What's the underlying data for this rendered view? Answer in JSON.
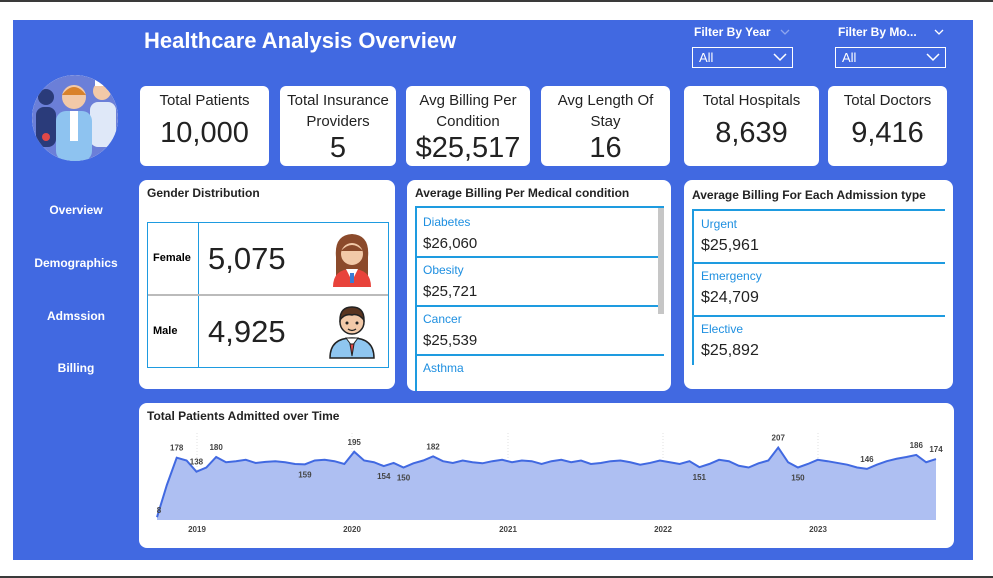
{
  "header": {
    "title": "Healthcare Analysis Overview"
  },
  "filters": {
    "year": {
      "label": "Filter By Year",
      "value": "All"
    },
    "month": {
      "label": "Filter By Mo...",
      "value": "All"
    }
  },
  "nav": {
    "items": [
      "Overview",
      "Demographics",
      "Admssion",
      "Billing"
    ]
  },
  "kpis": [
    {
      "label": "Total Patients",
      "value": "10,000"
    },
    {
      "label": "Total Insurance Providers",
      "value": "5"
    },
    {
      "label": "Avg Billing Per Condition",
      "value": "$25,517"
    },
    {
      "label": "Avg Length Of Stay",
      "value": "16"
    },
    {
      "label": "Total Hospitals",
      "value": "8,639"
    },
    {
      "label": "Total Doctors",
      "value": "9,416"
    }
  ],
  "gender": {
    "title": "Gender Distribution",
    "rows": [
      {
        "label": "Female",
        "value": "5,075"
      },
      {
        "label": "Male",
        "value": "4,925"
      }
    ]
  },
  "condition_billing": {
    "title": "Average Billing Per Medical condition",
    "items": [
      {
        "label": "Diabetes",
        "value": "$26,060"
      },
      {
        "label": "Obesity",
        "value": "$25,721"
      },
      {
        "label": "Cancer",
        "value": "$25,539"
      },
      {
        "label": "Asthma",
        "value": ""
      }
    ]
  },
  "admission_billing": {
    "title": "Average Billing For Each Admission type",
    "items": [
      {
        "label": "Urgent",
        "value": "$25,961"
      },
      {
        "label": "Emergency",
        "value": "$24,709"
      },
      {
        "label": "Elective",
        "value": "$25,892"
      }
    ]
  },
  "colors": {
    "board": "#4169e1",
    "accent": "#1e9be0",
    "area_fill": "#aebff2",
    "line": "#4169e1"
  },
  "chart_data": {
    "type": "area",
    "title": "Total Patients Admitted over Time",
    "x_ticks": [
      "2019",
      "2020",
      "2021",
      "2022",
      "2023"
    ],
    "values": [
      8,
      100,
      178,
      170,
      138,
      150,
      180,
      165,
      168,
      172,
      163,
      166,
      168,
      165,
      160,
      159,
      170,
      172,
      168,
      160,
      195,
      170,
      165,
      154,
      163,
      150,
      162,
      170,
      182,
      168,
      163,
      170,
      165,
      162,
      168,
      172,
      165,
      170,
      168,
      160,
      168,
      172,
      165,
      170,
      160,
      163,
      168,
      170,
      165,
      158,
      163,
      170,
      165,
      160,
      168,
      151,
      160,
      172,
      168,
      155,
      150,
      162,
      170,
      207,
      165,
      150,
      160,
      172,
      168,
      163,
      158,
      150,
      146,
      158,
      168,
      175,
      180,
      186,
      165,
      174
    ],
    "annotations": [
      {
        "index": 0,
        "label": "8"
      },
      {
        "index": 2,
        "label": "178"
      },
      {
        "index": 4,
        "label": "138"
      },
      {
        "index": 6,
        "label": "180"
      },
      {
        "index": 15,
        "label": "159"
      },
      {
        "index": 20,
        "label": "195"
      },
      {
        "index": 23,
        "label": "154"
      },
      {
        "index": 25,
        "label": "150"
      },
      {
        "index": 28,
        "label": "182"
      },
      {
        "index": 55,
        "label": "151"
      },
      {
        "index": 63,
        "label": "207"
      },
      {
        "index": 65,
        "label": "150"
      },
      {
        "index": 72,
        "label": "146"
      },
      {
        "index": 77,
        "label": "186"
      },
      {
        "index": 79,
        "label": "174"
      }
    ]
  }
}
